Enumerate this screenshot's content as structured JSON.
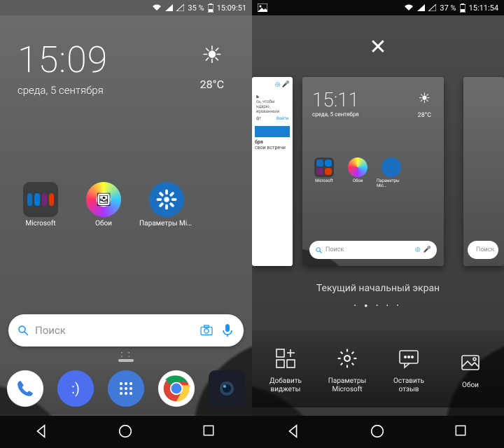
{
  "left": {
    "status": {
      "battery": "35 %",
      "time": "15:09:51"
    },
    "clock": {
      "time": "15:09",
      "date": "среда, 5 сентября"
    },
    "weather": {
      "temp": "28°C"
    },
    "apps": [
      {
        "label": "Microsoft"
      },
      {
        "label": "Обои"
      },
      {
        "label": "Параметры Micr..."
      }
    ],
    "search": {
      "placeholder": "Поиск"
    },
    "dock": [
      "phone",
      "messages",
      "apps",
      "chrome",
      "camera"
    ]
  },
  "right": {
    "status": {
      "battery": "37 %",
      "time": "15:11:54"
    },
    "miniclock": {
      "time": "15:11",
      "date": "среда, 5 сентября",
      "temp": "28°C"
    },
    "miniapps": [
      {
        "label": "Microsoft"
      },
      {
        "label": "Обои"
      },
      {
        "label": "Параметры Mic..."
      }
    ],
    "minisearch": "Поиск",
    "feed": {
      "snippet1": "ь\nсь, чтобы\nндарю,\nированным",
      "brand": "фт",
      "signin": "Войти",
      "snippet2": "бря",
      "snippet3": "свои встречи"
    },
    "caption": "Текущий начальный экран",
    "actions": [
      {
        "label": "Добавить\nвиджеты"
      },
      {
        "label": "Параметры\nMicrosoft"
      },
      {
        "label": "Оставить\nотзыв"
      },
      {
        "label": "Обои"
      }
    ]
  }
}
